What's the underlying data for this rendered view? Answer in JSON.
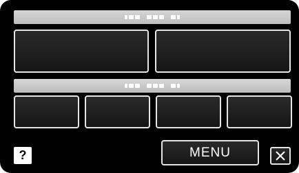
{
  "top_bar": {
    "label": ""
  },
  "middle_bar": {
    "label": ""
  },
  "bottom": {
    "help_label": "?",
    "menu_label": "MENU",
    "close_label": "✕"
  },
  "icons": {
    "help": "question-mark-icon",
    "close": "close-icon"
  },
  "colors": {
    "screen_bg": "#000000",
    "bar_bg": "#cfcfcf",
    "button_border": "#e6e6e6",
    "button_fill": "#1e1e1e"
  }
}
